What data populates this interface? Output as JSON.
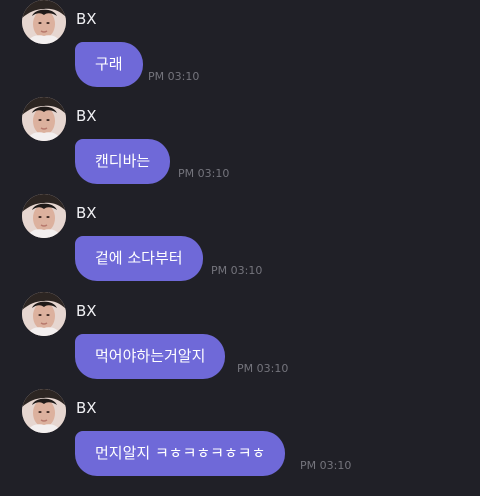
{
  "colors": {
    "background": "#202027",
    "bubble": "#6f69d8",
    "sender_text": "#f1f1f4",
    "message_text": "#ffffff",
    "timestamp_text": "#74747c"
  },
  "messages": [
    {
      "sender": "BX",
      "text": "구래",
      "time": "PM 03:10",
      "avatar_icon": "profile-photo"
    },
    {
      "sender": "BX",
      "text": "캔디바는",
      "time": "PM 03:10",
      "avatar_icon": "profile-photo"
    },
    {
      "sender": "BX",
      "text": "겉에 소다부터",
      "time": "PM 03:10",
      "avatar_icon": "profile-photo"
    },
    {
      "sender": "BX",
      "text": "먹어야하는거알지",
      "time": "PM 03:10",
      "avatar_icon": "profile-photo"
    },
    {
      "sender": "BX",
      "text": "먼지알지 ㅋㅎㅋㅎㅋㅎㅋㅎ",
      "time": "PM 03:10",
      "avatar_icon": "profile-photo"
    }
  ]
}
